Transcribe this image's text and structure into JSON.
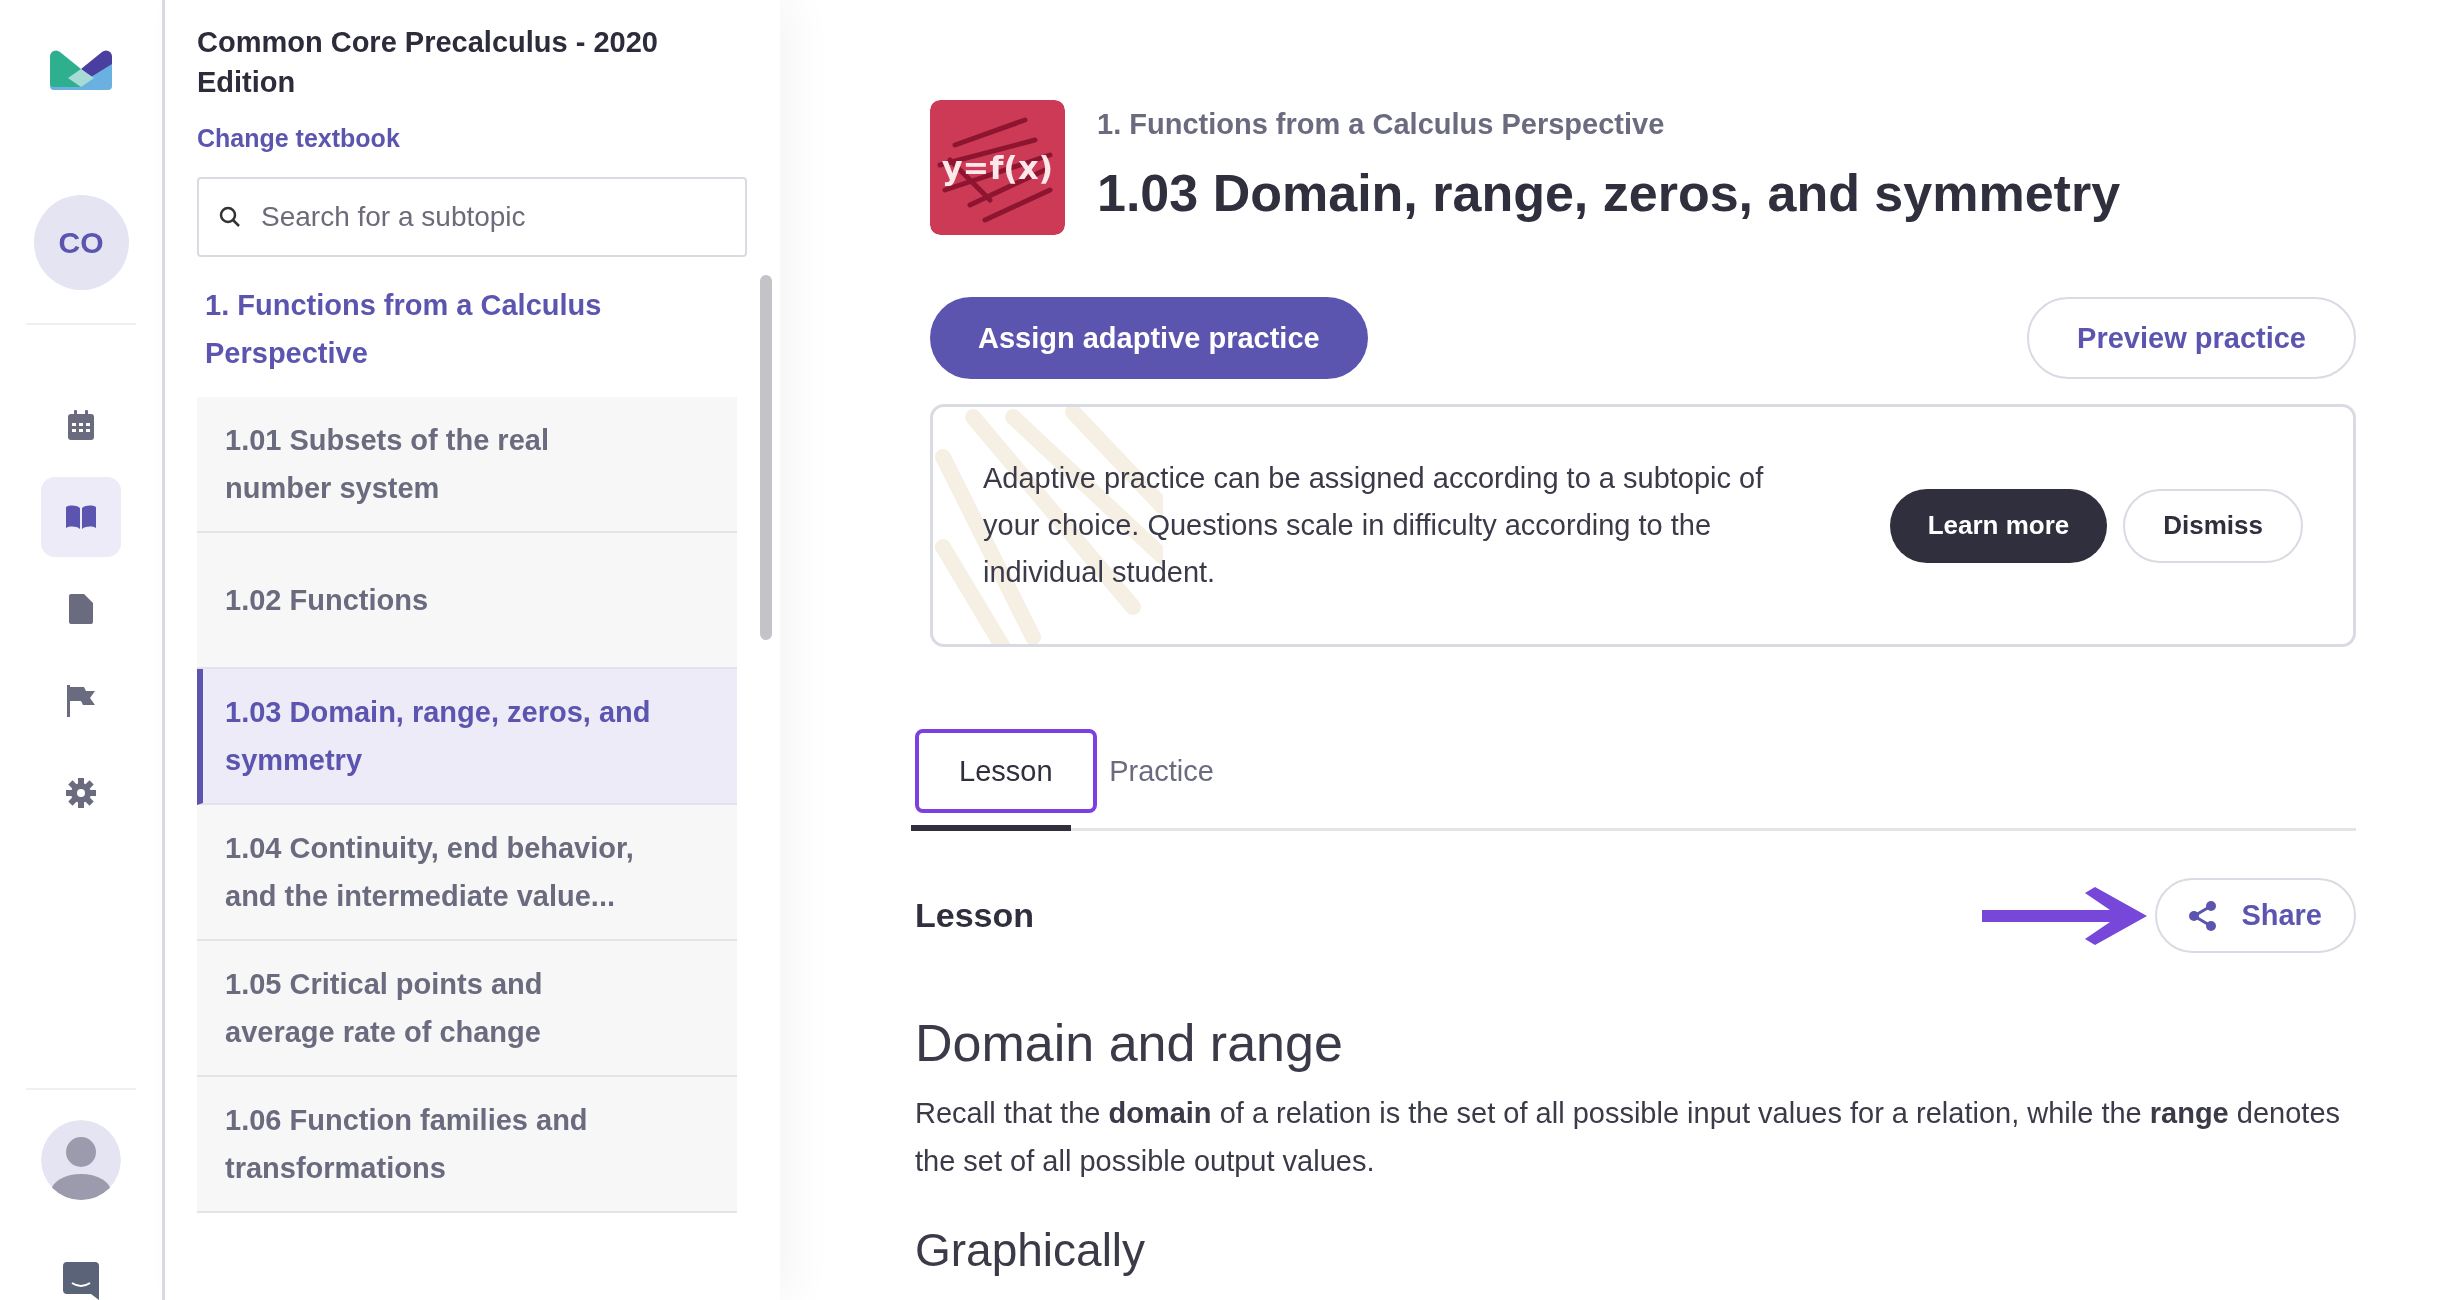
{
  "rail": {
    "avatar_initials": "CO",
    "nav": [
      {
        "kind": "calendar",
        "selected": false
      },
      {
        "kind": "book",
        "selected": true
      },
      {
        "kind": "document",
        "selected": false
      },
      {
        "kind": "flag",
        "selected": false
      },
      {
        "kind": "settings",
        "selected": false
      }
    ]
  },
  "sidebar": {
    "title": "Common Core Precalculus - 2020 Edition",
    "change_link": "Change textbook",
    "search": {
      "placeholder": "Search for a subtopic"
    },
    "section": "1. Functions from a Calculus Perspective",
    "items": [
      {
        "label": "1.01 Subsets of the real number system",
        "selected": false
      },
      {
        "label": "1.02 Functions",
        "selected": false
      },
      {
        "label": "1.03 Domain, range, zeros, and symmetry",
        "selected": true
      },
      {
        "label": "1.04 Continuity, end behavior, and the intermediate value...",
        "selected": false
      },
      {
        "label": "1.05 Critical points and average rate of change",
        "selected": false
      },
      {
        "label": "1.06 Function families and transformations",
        "selected": false
      }
    ]
  },
  "header": {
    "tile_text": "y=f(x)",
    "chapter": "1. Functions from a Calculus Perspective",
    "title": "1.03 Domain, range, zeros, and symmetry"
  },
  "actions": {
    "assign": "Assign adaptive practice",
    "preview": "Preview practice"
  },
  "banner": {
    "text": "Adaptive practice can be assigned according to a subtopic of your choice. Questions scale in difficulty according to the individual student.",
    "learn_more": "Learn more",
    "dismiss": "Dismiss"
  },
  "tabs": [
    {
      "label": "Lesson",
      "selected": true
    },
    {
      "label": "Practice",
      "selected": false
    }
  ],
  "lesson": {
    "heading": "Lesson",
    "share": "Share",
    "section_title": "Domain and range",
    "paragraph": "Recall that the **domain** of a relation is the set of all possible input values for a relation, while the **range** denotes the set of all possible output values.",
    "next_title": "Graphically"
  }
}
